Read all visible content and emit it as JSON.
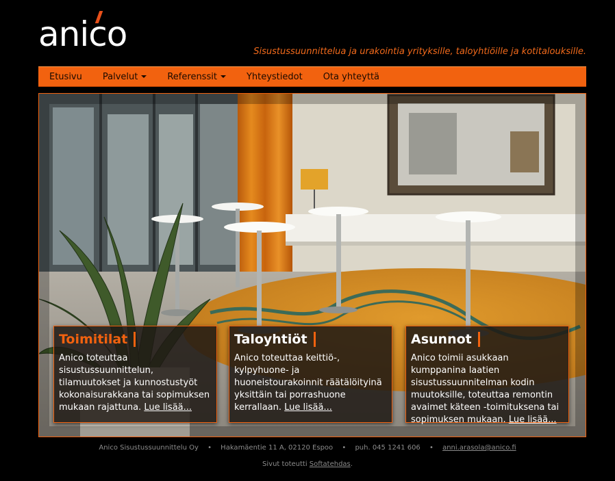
{
  "brand": {
    "logo_text": "anico",
    "accent_color": "#f2620f"
  },
  "header": {
    "tagline": "Sisustussuunnittelua ja urakointia yrityksille, taloyhtiöille ja kotitalouksille."
  },
  "nav": {
    "items": [
      {
        "label": "Etusivu",
        "dropdown": false
      },
      {
        "label": "Palvelut",
        "dropdown": true
      },
      {
        "label": "Referenssit",
        "dropdown": true
      },
      {
        "label": "Yhteystiedot",
        "dropdown": false
      },
      {
        "label": "Ota yhteyttä",
        "dropdown": false
      }
    ]
  },
  "boxes": [
    {
      "title": "Toimitilat",
      "text": "Anico toteuttaa sisustussuunnittelun, tilamuutokset ja kunnostustyöt kokonaisurakkana tai sopimuksen mukaan rajattuna.",
      "link": "Lue lisää..."
    },
    {
      "title": "Taloyhtiöt",
      "text": "Anico toteuttaa keittiö-, kylpyhuone- ja huoneistourakoinnit räätälöityinä yksittäin tai porrashuone kerrallaan.",
      "link": "Lue lisää..."
    },
    {
      "title": "Asunnot",
      "text": "Anico toimii asukkaan kumppanina laatien sisustussuunnitelman kodin muutoksille, toteuttaa remontin avaimet käteen -toimituksena tai sopimuksen mukaan.",
      "link": "Lue lisää..."
    }
  ],
  "footer": {
    "company": "Anico Sisustussuunnittelu Oy",
    "address": "Hakamäentie 11 A, 02120 Espoo",
    "phone": "puh. 045 1241 606",
    "email": "anni.arasola@anico.fi",
    "separator": "•",
    "credit_prefix": "Sivut toteutti",
    "credit_link": "Softatehdas",
    "credit_suffix": "."
  }
}
